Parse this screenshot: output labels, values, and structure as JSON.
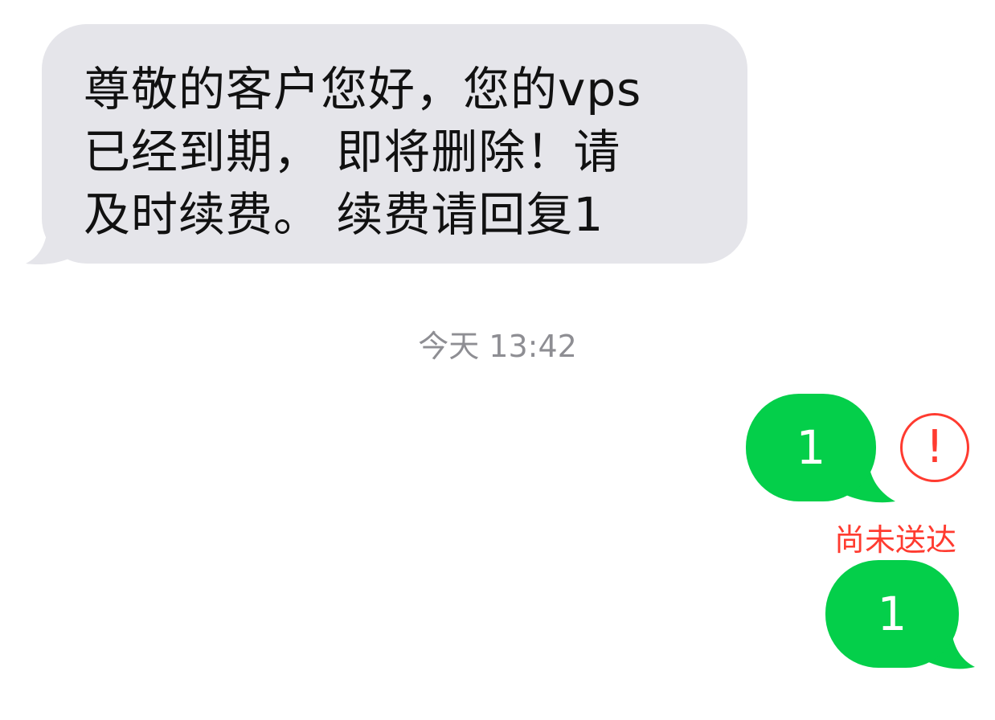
{
  "conversation": {
    "incoming": {
      "text": "尊敬的客户您好，您的vps\n已经到期， 即将删除！请\n及时续费。 续费请回复1",
      "bubble_color": "#e5e5ea"
    },
    "timestamp": "今天 13:42",
    "outgoing": [
      {
        "text": "1",
        "status": "尚未送达",
        "error_icon": "exclamation-circle-icon",
        "error_glyph": "!"
      },
      {
        "text": "1"
      }
    ]
  },
  "colors": {
    "outgoing_bubble": "#04cf4a",
    "error": "#ff3b30",
    "timestamp": "#8e8e93"
  }
}
